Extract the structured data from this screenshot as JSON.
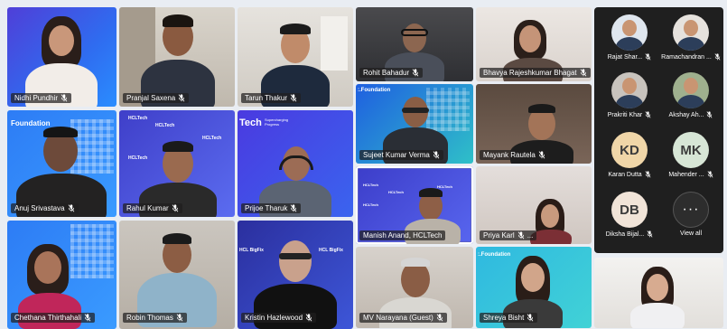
{
  "participants": [
    {
      "name": "Nidhi Pundhir",
      "muted": true
    },
    {
      "name": "Pranjal Saxena",
      "muted": true
    },
    {
      "name": "Tarun Thakur",
      "muted": true
    },
    {
      "name": "Rohit Bahadur",
      "muted": true
    },
    {
      "name": "Bhavya Rajeshkumar Bhagat",
      "muted": true
    },
    {
      "name": "Anuj Srivastava",
      "muted": true
    },
    {
      "name": "Rahul Kumar",
      "muted": true
    },
    {
      "name": "Prijoe Tharuk",
      "muted": true
    },
    {
      "name": "Sujeet Kumar Verma",
      "muted": true
    },
    {
      "name": "Mayank Rautela",
      "muted": true
    },
    {
      "name": "Manish Anand, HCLTech",
      "muted": false
    },
    {
      "name": "Priya Karl",
      "muted": true,
      "more": "..."
    },
    {
      "name": "Chethana Thirthahali",
      "muted": true
    },
    {
      "name": "Robin Thomas",
      "muted": true
    },
    {
      "name": "Kristin Hazlewood",
      "muted": true
    },
    {
      "name": "MV Narayana (Guest)",
      "muted": true
    },
    {
      "name": "Shreya Bisht",
      "muted": true
    }
  ],
  "backgrounds": {
    "hcltech_small": "HCLTech",
    "tech_banner": "Tech",
    "tech_banner_sub": "Supercharging Progress",
    "foundation": ":.Foundation",
    "foundation_short": "Foundation",
    "bigfix": "HCL BigFix"
  },
  "sidebar": {
    "people": [
      {
        "name": "Rajat Shar...",
        "avatar": "photo"
      },
      {
        "name": "Ramachandran ...",
        "avatar": "photo"
      },
      {
        "name": "Prakriti Khar",
        "avatar": "photo"
      },
      {
        "name": "Akshay Ah...",
        "avatar": "photo"
      },
      {
        "name": "Karan Dutta",
        "avatar": "initials",
        "initials": "KD"
      },
      {
        "name": "Mahender ...",
        "avatar": "initials",
        "initials": "MK"
      },
      {
        "name": "Diksha Bijal...",
        "avatar": "initials",
        "initials": "DB"
      }
    ],
    "view_all_label": "View all",
    "more_glyph": "···"
  },
  "colors": {
    "mic_muted": "#ffffff",
    "active_border": "#5b5fc7",
    "initials_avatar_bg": "#f0d6a8"
  }
}
